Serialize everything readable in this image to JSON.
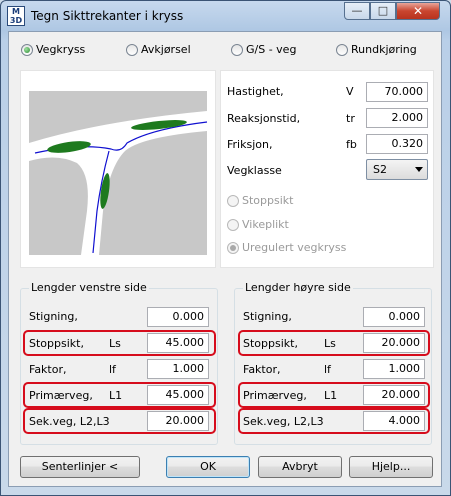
{
  "window": {
    "title": "Tegn Sikttrekanter i kryss",
    "app_icon_lines": [
      "M",
      "3D"
    ],
    "minimize_glyph": "—",
    "maximize_glyph": "□",
    "close_glyph": "✕"
  },
  "crossing_types": [
    {
      "label": "Vegkryss",
      "selected": true
    },
    {
      "label": "Avkjørsel",
      "selected": false
    },
    {
      "label": "G/S - veg",
      "selected": false
    },
    {
      "label": "Rundkjøring",
      "selected": false
    }
  ],
  "params": {
    "speed": {
      "label": "Hastighet,",
      "symbol": "V",
      "value": "70.000"
    },
    "reaction": {
      "label": "Reaksjonstid,",
      "symbol": "tr",
      "value": "2.000"
    },
    "friction": {
      "label": "Friksjon,",
      "symbol": "fb",
      "value": "0.320"
    },
    "road_class": {
      "label": "Vegklasse",
      "value": "S2"
    }
  },
  "sight_options": [
    {
      "label": "Stoppsikt",
      "selected": false
    },
    {
      "label": "Vikeplikt",
      "selected": false
    },
    {
      "label": "Uregulert vegkryss",
      "selected": true
    }
  ],
  "left_group": {
    "title": "Lengder venstre side",
    "rows": [
      {
        "label": "Stigning,",
        "symbol": "",
        "value": "0.000",
        "highlighted": false
      },
      {
        "label": "Stoppsikt,",
        "symbol": "Ls",
        "value": "45.000",
        "highlighted": true
      },
      {
        "label": "Faktor,",
        "symbol": "lf",
        "value": "1.000",
        "highlighted": false
      },
      {
        "label": "Primærveg,",
        "symbol": "L1",
        "value": "45.000",
        "highlighted": true
      },
      {
        "label": "Sek.veg, L2,L3",
        "symbol": "",
        "value": "20.000",
        "highlighted": true
      }
    ]
  },
  "right_group": {
    "title": "Lengder høyre side",
    "rows": [
      {
        "label": "Stigning,",
        "symbol": "",
        "value": "0.000",
        "highlighted": false
      },
      {
        "label": "Stoppsikt,",
        "symbol": "Ls",
        "value": "20.000",
        "highlighted": true
      },
      {
        "label": "Faktor,",
        "symbol": "lf",
        "value": "1.000",
        "highlighted": false
      },
      {
        "label": "Primærveg,",
        "symbol": "L1",
        "value": "20.000",
        "highlighted": true
      },
      {
        "label": "Sek.veg, L2,L3",
        "symbol": "",
        "value": "4.000",
        "highlighted": true
      }
    ]
  },
  "buttons": {
    "centerlines": "Senterlinjer <",
    "ok": "OK",
    "cancel": "Avbryt",
    "help": "Hjelp..."
  },
  "colors": {
    "highlight": "#d60c1c",
    "road": "#ffffff",
    "ground": "#c8c8c8",
    "island": "#1e7a1e",
    "centerline": "#1010d0"
  }
}
